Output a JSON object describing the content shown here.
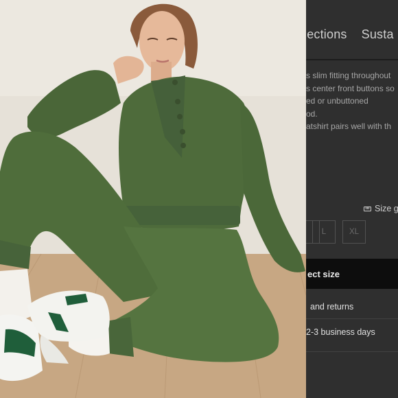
{
  "product_photo": {
    "description": "product-photo",
    "colors": {
      "garment": "#4d6a3a",
      "wall": "#e7e2d9",
      "floor": "#c8a985",
      "sneaker_accent": "#1f5e3a"
    }
  },
  "nav": {
    "items": [
      {
        "label": "lections"
      },
      {
        "label": "Susta"
      }
    ]
  },
  "description_lines": [
    "s slim fitting throughout",
    "s center front buttons so",
    "ed or unbuttoned",
    "od.",
    "atshirt pairs well with th"
  ],
  "size_guide": {
    "label": "Size g",
    "icon": "ruler-icon"
  },
  "sizes": [
    {
      "label": ""
    },
    {
      "label": "L"
    },
    {
      "label": "XL"
    }
  ],
  "select_size_button": {
    "label": "ect size"
  },
  "shipping": {
    "returns_label": "and returns",
    "delivery_label": "2-3 business days"
  },
  "colors": {
    "overlay": "#2f2f2f",
    "cta": "#0d0d0d",
    "text_muted": "#a6a6a6"
  }
}
